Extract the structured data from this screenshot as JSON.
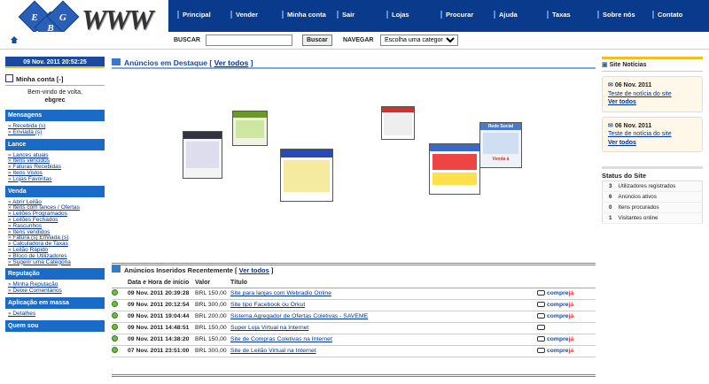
{
  "logo": {
    "letters": [
      "E",
      "B",
      "G"
    ],
    "wordmark": "WWW"
  },
  "nav": [
    "Principal",
    "Vender",
    "Minha conta",
    "Sair",
    "Lojas",
    "Procurar",
    "Ajuda",
    "Taxas",
    "Sobre nós",
    "Contato"
  ],
  "search": {
    "label": "BUSCAR",
    "button": "Buscar",
    "nav_label": "NAVEGAR",
    "category": "Escolha uma categoria"
  },
  "left": {
    "date": "09 Nov. 2011 20:52:25",
    "account_title": "Minha conta [-]",
    "welcome_line1": "Bem-vindo de volta,",
    "welcome_user": "ebgrec",
    "sections": [
      {
        "title": "Mensagens",
        "links": [
          "Recebida (s)",
          "Enviada (s)"
        ]
      },
      {
        "title": "Lance",
        "links": [
          "Lances atuais",
          "Itens vencidos",
          "Faturas Recebidas",
          "Itens Vistos",
          "Lojas Favoritas"
        ]
      },
      {
        "title": "Venda",
        "links": [
          "Abrir Leilão",
          "Itens com lances / Ofertas",
          "Leilões Programados",
          "Leilões Fechados",
          "Rascunhos",
          "Itens vendidos",
          "Fatura (s) Enviada (s)",
          "Calculadora de Taxas",
          "Leilão Rápido",
          "Bloco de Utilizadores",
          "Sugerir uma Categoria"
        ]
      },
      {
        "title": "Reputação",
        "links": [
          "Minha Reputação",
          "Deixe Comentários"
        ]
      },
      {
        "title": "Aplicação em massa",
        "links": [
          "Detalhes"
        ]
      },
      {
        "title": "Quem sou",
        "links": []
      }
    ]
  },
  "featured": {
    "title": "Anúncios em Destaque",
    "link": "Ver todos",
    "shot_text": "Rede Social",
    "shot_text2": "Venda à"
  },
  "recent": {
    "title": "Anúncios Inseridos Recentemente",
    "link": "Ver todos",
    "headers": [
      "Data e Hora de início",
      "Valor",
      "Título"
    ],
    "buy": "compre",
    "buy2": "já",
    "rows": [
      {
        "date": "09 Nov. 2011 20:39:28",
        "value": "BRL 150,00",
        "title": "Site para lanjas com Webradio Online",
        "buy": true
      },
      {
        "date": "09 Nov. 2011 20:12:54",
        "value": "BRL 300,00",
        "title": "Site tipo Facebook ou Orkut",
        "buy": true
      },
      {
        "date": "09 Nov. 2011 19:04:44",
        "value": "BRL 200,00",
        "title": "Sistema Agregador de Ofertas Coletivas - SAVEME",
        "buy": true
      },
      {
        "date": "09 Nov. 2011 14:48:51",
        "value": "BRL 150,00",
        "title": "Super Loja Virtual na Internet",
        "buy": false
      },
      {
        "date": "09 Nov. 2011 14:38:20",
        "value": "BRL 150,00",
        "title": "Site de Compras Coletivas na Internet",
        "buy": true
      },
      {
        "date": "07 Nov. 2011 23:51:00",
        "value": "BRL 300,00",
        "title": "Site de Leilão Virtual na Internet",
        "buy": true
      }
    ]
  },
  "news": {
    "title": "Site Notícias",
    "items": [
      {
        "date": "06 Nov. 2011",
        "text": "Teste de notícia do site",
        "link": "Ver todos"
      },
      {
        "date": "06 Nov. 2011",
        "text": "Teste de notícia do site",
        "link": "Ver todos"
      }
    ]
  },
  "status": {
    "title": "Status do Site",
    "rows": [
      {
        "n": "3",
        "label": "Utilizadores registrados"
      },
      {
        "n": "6",
        "label": "Anúncios ativos"
      },
      {
        "n": "0",
        "label": "Itens procurados"
      },
      {
        "n": "1",
        "label": "Visitantes online"
      }
    ]
  }
}
